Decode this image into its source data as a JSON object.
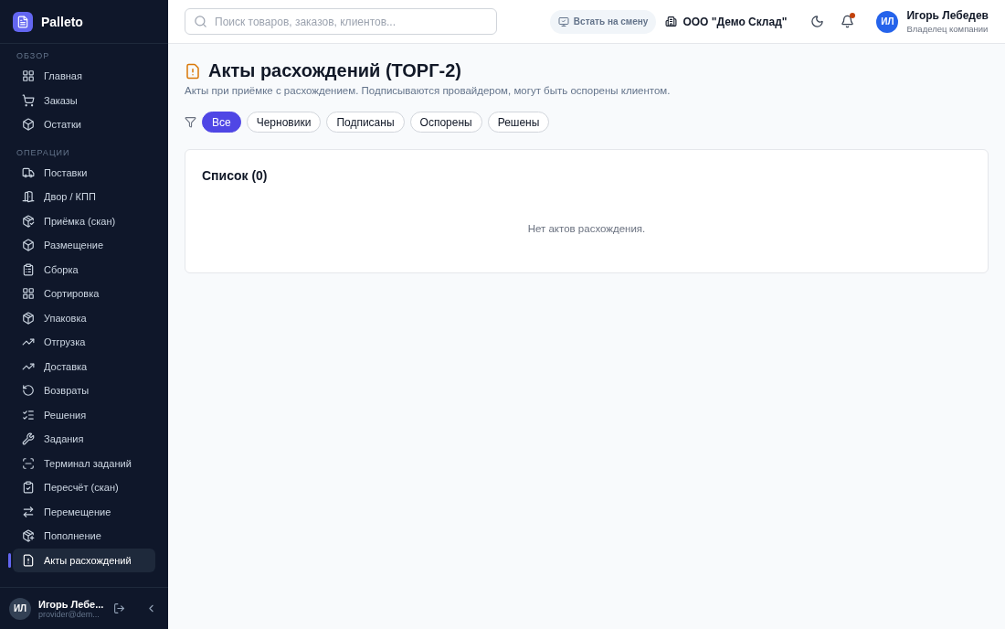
{
  "sidebar": {
    "brand": "Palleto",
    "sections": [
      {
        "title": "ОБЗОР",
        "items": [
          {
            "label": "Главная",
            "selected": false
          },
          {
            "label": "Заказы",
            "selected": false
          },
          {
            "label": "Остатки",
            "selected": false
          }
        ]
      },
      {
        "title": "ОПЕРАЦИИ",
        "items": [
          {
            "label": "Поставки",
            "selected": false
          },
          {
            "label": "Двор / КПП",
            "selected": false
          },
          {
            "label": "Приёмка (скан)",
            "selected": false
          },
          {
            "label": "Размещение",
            "selected": false
          },
          {
            "label": "Сборка",
            "selected": false
          },
          {
            "label": "Сортировка",
            "selected": false
          },
          {
            "label": "Упаковка",
            "selected": false
          },
          {
            "label": "Отгрузка",
            "selected": false
          },
          {
            "label": "Доставка",
            "selected": false
          },
          {
            "label": "Возвраты",
            "selected": false
          },
          {
            "label": "Решения",
            "selected": false
          },
          {
            "label": "Задания",
            "selected": false
          },
          {
            "label": "Терминал заданий",
            "selected": false
          },
          {
            "label": "Пересчёт (скан)",
            "selected": false
          },
          {
            "label": "Перемещение",
            "selected": false
          },
          {
            "label": "Пополнение",
            "selected": false
          },
          {
            "label": "Акты расхождений",
            "selected": true
          }
        ]
      }
    ],
    "user": {
      "initials": "ИЛ",
      "name": "Игорь Лебе...",
      "email": "provider@dem..."
    }
  },
  "topbar": {
    "search": {
      "placeholder": "Поиск товаров, заказов, клиентов..."
    },
    "shift_button": "Встать на смену",
    "company": "ООО \"Демо Склад\"",
    "notifications_unread": true,
    "user": {
      "initials": "ИЛ",
      "name": "Игорь Лебедев",
      "role": "Владелец компании"
    }
  },
  "page": {
    "title": "Акты расхождений (ТОРГ-2)",
    "subtitle": "Акты при приёмке с расхождением. Подписываются провайдером, могут быть оспорены клиентом.",
    "filters": [
      {
        "label": "Все",
        "selected": true
      },
      {
        "label": "Черновики",
        "selected": false
      },
      {
        "label": "Подписаны",
        "selected": false
      },
      {
        "label": "Оспорены",
        "selected": false
      },
      {
        "label": "Решены",
        "selected": false
      }
    ],
    "list": {
      "title": "Список (0)",
      "empty_text": "Нет актов расхождения."
    }
  }
}
